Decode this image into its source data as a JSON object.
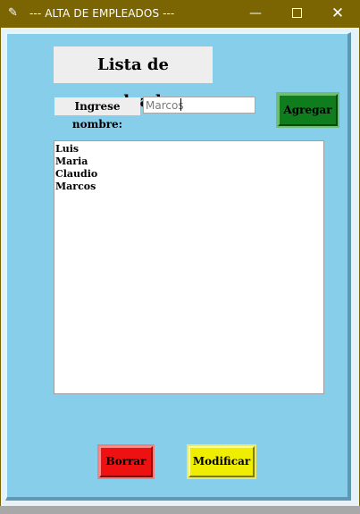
{
  "window": {
    "title": "--- ALTA DE EMPLEADOS ---",
    "icon": "feather-icon",
    "minimize_glyph": "—",
    "close_glyph": "✕"
  },
  "main": {
    "heading": "Lista de empleados",
    "name_label": "Ingrese nombre:",
    "name_value": "Marcos",
    "add_button": "Agregar",
    "delete_button": "Borrar",
    "modify_button": "Modificar",
    "employees": [
      "Luis",
      "Maria",
      "Claudio",
      "Marcos"
    ]
  },
  "colors": {
    "titlebar": "#7a6502",
    "frame": "#87ceeb",
    "add_button": "#0f7d1e",
    "delete_button": "#ee1111",
    "modify_button": "#f0ee00"
  }
}
